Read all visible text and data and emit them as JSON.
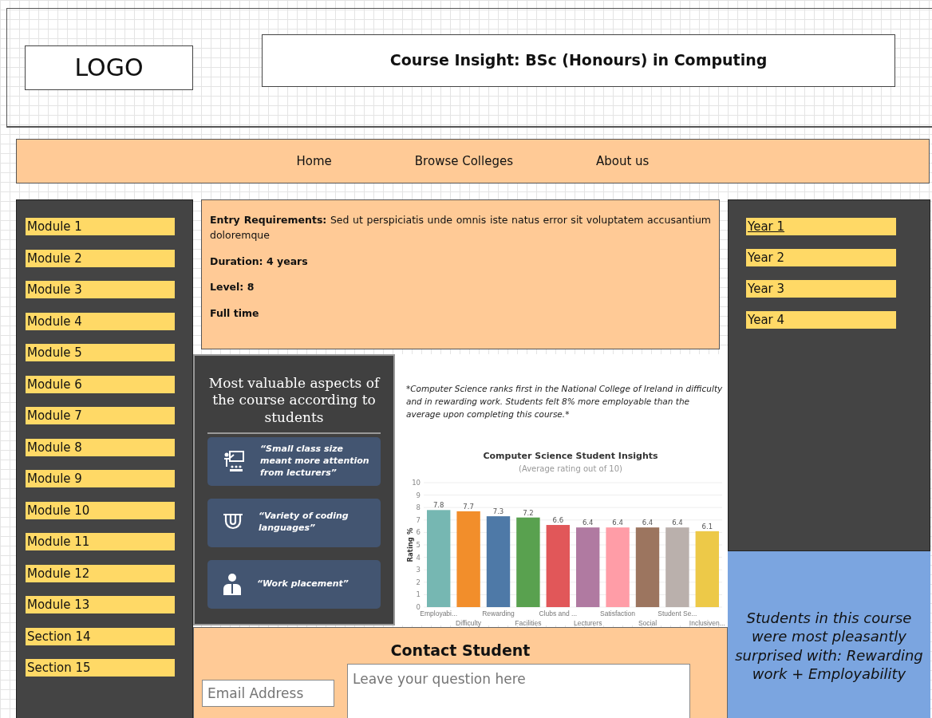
{
  "header": {
    "logo": "LOGO",
    "title": "Course Insight: BSc (Honours) in Computing"
  },
  "nav": [
    {
      "label": "Home"
    },
    {
      "label": "Browse Colleges"
    },
    {
      "label": "About us"
    }
  ],
  "modules": [
    "Module 1",
    "Module 2",
    "Module 3",
    "Module 4",
    "Module 5",
    "Module 6",
    "Module 7",
    "Module 8",
    "Module 9",
    "Module 10",
    "Module 11",
    "Module 12",
    "Module 13",
    "Section 14",
    "Section 15"
  ],
  "course_info": [
    {
      "label": "Entry Requirements:",
      "text": "Sed ut perspiciatis unde omnis iste natus error sit voluptatem accusantium doloremque"
    },
    {
      "label": "Duration: 4 years"
    },
    {
      "label": "Level: 8"
    },
    {
      "label": "Full time"
    }
  ],
  "years": [
    {
      "label": "Year 1",
      "selected": true
    },
    {
      "label": "Year 2",
      "selected": false
    },
    {
      "label": "Year 3",
      "selected": false
    },
    {
      "label": "Year 4",
      "selected": false
    }
  ],
  "aspects": {
    "title": "Most valuable aspects of the course according to students",
    "items": [
      {
        "kind": "teacher",
        "quote": "“Small class size meant more attention from lecturers”"
      },
      {
        "kind": "magnet",
        "quote": "“Variety of coding languages”"
      },
      {
        "kind": "worker",
        "quote": "“Work placement”"
      }
    ]
  },
  "insight": {
    "note": "*Computer Science ranks first in the National College of Ireland in difficulty and in rewarding work. Students felt 8% more employable than the average upon completing this course.*",
    "chart_data": {
      "type": "bar",
      "title": "Computer Science Student Insights",
      "subtitle": "(Average rating out of 10)",
      "ylabel": "Rating %",
      "categories": [
        "Employabi...",
        "Difficulty",
        "Rewarding",
        "Facilities",
        "Clubs and ...",
        "Lecturers",
        "Satisfaction",
        "Social",
        "Student Se...",
        "Inclusiven..."
      ],
      "values": [
        7.8,
        7.7,
        7.3,
        7.2,
        6.6,
        6.4,
        6.4,
        6.4,
        6.4,
        6.1
      ],
      "colors": [
        "#76b7b2",
        "#f28e2b",
        "#4e79a7",
        "#59a14f",
        "#e15759",
        "#b07aa1",
        "#ff9da7",
        "#9c755f",
        "#bab0ac",
        "#edc948"
      ],
      "ylim": [
        0,
        10
      ],
      "yticks": [
        0,
        1,
        2,
        3,
        4,
        5,
        6,
        7,
        8,
        9,
        10
      ],
      "data_labels": true,
      "grid": true
    }
  },
  "surprise": "Students in this course were most pleasantly surprised with: Rewarding work + Employability",
  "contact": {
    "title": "Contact Student",
    "email_placeholder": "Email Address",
    "question_placeholder": "Leave your question here"
  }
}
